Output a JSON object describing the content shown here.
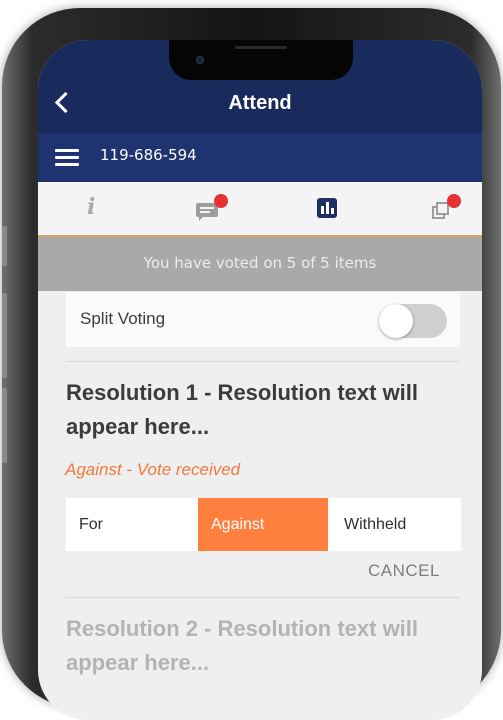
{
  "header": {
    "title": "Attend",
    "back_icon": "chevron-left-icon"
  },
  "subbar": {
    "meeting_id": "119-686-594",
    "menu_icon": "hamburger-menu-icon"
  },
  "iconbar": {
    "items": [
      {
        "icon": "info-icon",
        "badge": false
      },
      {
        "icon": "chat-icon",
        "badge": true
      },
      {
        "icon": "poll-icon",
        "badge": false,
        "active": true
      },
      {
        "icon": "documents-icon",
        "badge": true
      }
    ],
    "active_underline_color": "#d9a56a",
    "badge_color": "#e63232"
  },
  "banner": {
    "text": "You have voted on 5 of 5 items"
  },
  "split_voting": {
    "label": "Split Voting",
    "enabled": false
  },
  "resolutions": [
    {
      "title": "Resolution 1 - Resolution text will appear here...",
      "status": "Against - Vote received",
      "options": [
        "For",
        "Against",
        "Withheld"
      ],
      "selected": "Against",
      "cancel_label": "CANCEL"
    },
    {
      "title": "Resolution 2 - Resolution text will appear here..."
    }
  ],
  "colors": {
    "navy": "#192a5c",
    "navy_bar": "#1e3370",
    "accent": "#ff7f3f",
    "status": "#f07a3a"
  }
}
